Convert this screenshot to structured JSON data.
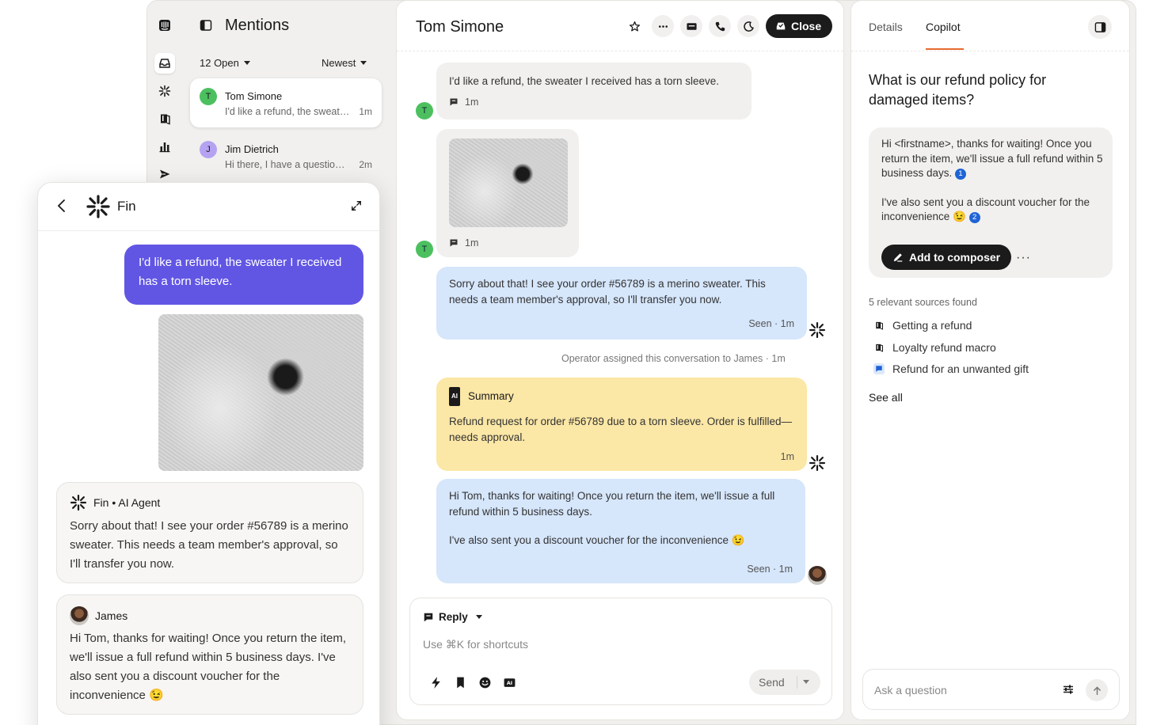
{
  "mentions": {
    "title": "Mentions",
    "open_filter": "12 Open",
    "sort_filter": "Newest",
    "conversations": [
      {
        "initial": "T",
        "name": "Tom Simone",
        "preview": "I'd like a refund, the sweater I received has a torn sleeve.",
        "time": "1m",
        "avatar_color": "#4cc05f"
      },
      {
        "initial": "J",
        "name": "Jim Dietrich",
        "preview": "Hi there, I have a question about my order",
        "time": "2m",
        "avatar_color": "#b5a3f2"
      }
    ]
  },
  "conversation": {
    "name": "Tom Simone",
    "close_label": "Close",
    "customer_initial": "T",
    "messages": {
      "m1_text": "I'd like a refund, the sweater I received has a torn sleeve.",
      "m1_time": "1m",
      "m2_time": "1m",
      "m3_text": "Sorry about that! I see your order #56789 is a merino sweater. This needs a team member's approval, so I'll transfer you now.",
      "m3_status": "Seen · 1m",
      "system_note": "Operator assigned this conversation to James · 1m",
      "summary_badge": "AI",
      "summary_title": "Summary",
      "summary_text": "Refund request for order #56789 due to a torn sleeve. Order is fulfilled—needs approval.",
      "summary_time": "1m",
      "m5_text1": "Hi Tom, thanks for waiting! Once you return the item, we'll issue a full refund within 5 business days.",
      "m5_text2": "I've also sent you a discount voucher for the inconvenience 😉",
      "m5_status": "Seen · 1m"
    },
    "reply": {
      "label": "Reply",
      "placeholder": "Use ⌘K for shortcuts",
      "send_label": "Send"
    }
  },
  "copilot": {
    "tabs": [
      "Details",
      "Copilot"
    ],
    "question": "What is our refund policy for damaged items?",
    "answer_p1": "Hi <firstname>, thanks for waiting! Once you return the item, we'll issue a full refund within 5 business days.",
    "answer_cite1": "1",
    "answer_p2": "I've also sent you a discount voucher for the inconvenience 😉",
    "answer_cite2": "2",
    "add_to_composer": "Add to composer",
    "more": "···",
    "sources_heading": "5 relevant sources found",
    "sources": [
      {
        "label": "Getting a refund",
        "icon": "book-icon"
      },
      {
        "label": "Loyalty refund macro",
        "icon": "book-icon"
      },
      {
        "label": "Refund for an unwanted gift",
        "icon": "chat-icon"
      }
    ],
    "see_all": "See all",
    "ask_placeholder": "Ask a question"
  },
  "fin_widget": {
    "title": "Fin",
    "user_message": "I'd like a refund, the sweater I received has a torn sleeve.",
    "agent_name": "Fin • AI Agent",
    "agent_message": "Sorry about that! I see your order #56789 is a merino sweater. This needs a team member's approval, so I'll transfer you now.",
    "human_name": "James",
    "human_message": "Hi Tom, thanks for waiting! Once you return the item, we'll issue a full refund within 5 business days. I've also sent you a discount voucher for the inconvenience 😉"
  },
  "colors": {
    "accent_purple": "#6156e4",
    "tab_underline": "#e5692d",
    "bubble_blue": "#d6e6fb",
    "bubble_yellow": "#fbe7a6",
    "citation_blue": "#1f63d6"
  }
}
